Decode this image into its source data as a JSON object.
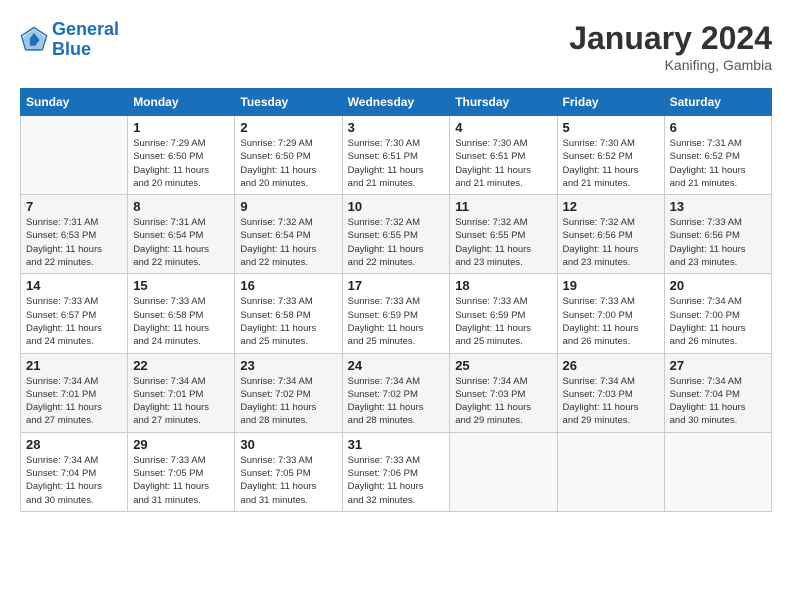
{
  "header": {
    "logo_line1": "General",
    "logo_line2": "Blue",
    "month_year": "January 2024",
    "location": "Kanifing, Gambia"
  },
  "days_of_week": [
    "Sunday",
    "Monday",
    "Tuesday",
    "Wednesday",
    "Thursday",
    "Friday",
    "Saturday"
  ],
  "weeks": [
    [
      {
        "day": "",
        "info": ""
      },
      {
        "day": "1",
        "info": "Sunrise: 7:29 AM\nSunset: 6:50 PM\nDaylight: 11 hours\nand 20 minutes."
      },
      {
        "day": "2",
        "info": "Sunrise: 7:29 AM\nSunset: 6:50 PM\nDaylight: 11 hours\nand 20 minutes."
      },
      {
        "day": "3",
        "info": "Sunrise: 7:30 AM\nSunset: 6:51 PM\nDaylight: 11 hours\nand 21 minutes."
      },
      {
        "day": "4",
        "info": "Sunrise: 7:30 AM\nSunset: 6:51 PM\nDaylight: 11 hours\nand 21 minutes."
      },
      {
        "day": "5",
        "info": "Sunrise: 7:30 AM\nSunset: 6:52 PM\nDaylight: 11 hours\nand 21 minutes."
      },
      {
        "day": "6",
        "info": "Sunrise: 7:31 AM\nSunset: 6:52 PM\nDaylight: 11 hours\nand 21 minutes."
      }
    ],
    [
      {
        "day": "7",
        "info": "Sunrise: 7:31 AM\nSunset: 6:53 PM\nDaylight: 11 hours\nand 22 minutes."
      },
      {
        "day": "8",
        "info": "Sunrise: 7:31 AM\nSunset: 6:54 PM\nDaylight: 11 hours\nand 22 minutes."
      },
      {
        "day": "9",
        "info": "Sunrise: 7:32 AM\nSunset: 6:54 PM\nDaylight: 11 hours\nand 22 minutes."
      },
      {
        "day": "10",
        "info": "Sunrise: 7:32 AM\nSunset: 6:55 PM\nDaylight: 11 hours\nand 22 minutes."
      },
      {
        "day": "11",
        "info": "Sunrise: 7:32 AM\nSunset: 6:55 PM\nDaylight: 11 hours\nand 23 minutes."
      },
      {
        "day": "12",
        "info": "Sunrise: 7:32 AM\nSunset: 6:56 PM\nDaylight: 11 hours\nand 23 minutes."
      },
      {
        "day": "13",
        "info": "Sunrise: 7:33 AM\nSunset: 6:56 PM\nDaylight: 11 hours\nand 23 minutes."
      }
    ],
    [
      {
        "day": "14",
        "info": "Sunrise: 7:33 AM\nSunset: 6:57 PM\nDaylight: 11 hours\nand 24 minutes."
      },
      {
        "day": "15",
        "info": "Sunrise: 7:33 AM\nSunset: 6:58 PM\nDaylight: 11 hours\nand 24 minutes."
      },
      {
        "day": "16",
        "info": "Sunrise: 7:33 AM\nSunset: 6:58 PM\nDaylight: 11 hours\nand 25 minutes."
      },
      {
        "day": "17",
        "info": "Sunrise: 7:33 AM\nSunset: 6:59 PM\nDaylight: 11 hours\nand 25 minutes."
      },
      {
        "day": "18",
        "info": "Sunrise: 7:33 AM\nSunset: 6:59 PM\nDaylight: 11 hours\nand 25 minutes."
      },
      {
        "day": "19",
        "info": "Sunrise: 7:33 AM\nSunset: 7:00 PM\nDaylight: 11 hours\nand 26 minutes."
      },
      {
        "day": "20",
        "info": "Sunrise: 7:34 AM\nSunset: 7:00 PM\nDaylight: 11 hours\nand 26 minutes."
      }
    ],
    [
      {
        "day": "21",
        "info": "Sunrise: 7:34 AM\nSunset: 7:01 PM\nDaylight: 11 hours\nand 27 minutes."
      },
      {
        "day": "22",
        "info": "Sunrise: 7:34 AM\nSunset: 7:01 PM\nDaylight: 11 hours\nand 27 minutes."
      },
      {
        "day": "23",
        "info": "Sunrise: 7:34 AM\nSunset: 7:02 PM\nDaylight: 11 hours\nand 28 minutes."
      },
      {
        "day": "24",
        "info": "Sunrise: 7:34 AM\nSunset: 7:02 PM\nDaylight: 11 hours\nand 28 minutes."
      },
      {
        "day": "25",
        "info": "Sunrise: 7:34 AM\nSunset: 7:03 PM\nDaylight: 11 hours\nand 29 minutes."
      },
      {
        "day": "26",
        "info": "Sunrise: 7:34 AM\nSunset: 7:03 PM\nDaylight: 11 hours\nand 29 minutes."
      },
      {
        "day": "27",
        "info": "Sunrise: 7:34 AM\nSunset: 7:04 PM\nDaylight: 11 hours\nand 30 minutes."
      }
    ],
    [
      {
        "day": "28",
        "info": "Sunrise: 7:34 AM\nSunset: 7:04 PM\nDaylight: 11 hours\nand 30 minutes."
      },
      {
        "day": "29",
        "info": "Sunrise: 7:33 AM\nSunset: 7:05 PM\nDaylight: 11 hours\nand 31 minutes."
      },
      {
        "day": "30",
        "info": "Sunrise: 7:33 AM\nSunset: 7:05 PM\nDaylight: 11 hours\nand 31 minutes."
      },
      {
        "day": "31",
        "info": "Sunrise: 7:33 AM\nSunset: 7:06 PM\nDaylight: 11 hours\nand 32 minutes."
      },
      {
        "day": "",
        "info": ""
      },
      {
        "day": "",
        "info": ""
      },
      {
        "day": "",
        "info": ""
      }
    ]
  ]
}
